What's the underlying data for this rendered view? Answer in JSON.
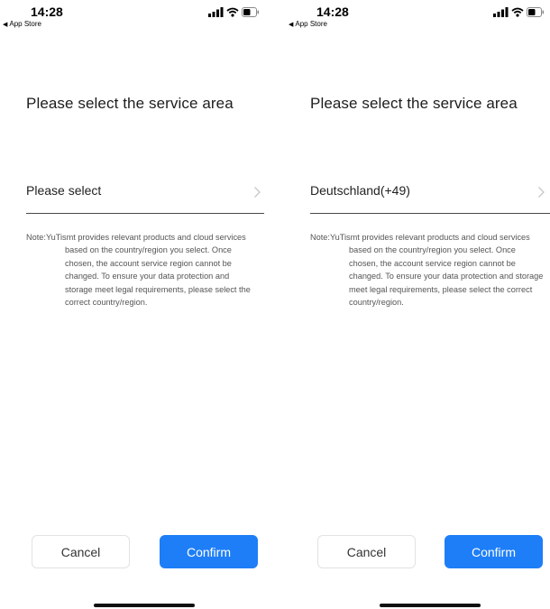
{
  "screens": [
    {
      "status_bar": {
        "time": "14:28",
        "back_label": "App Store",
        "back_arrow": "◀"
      },
      "title": "Please select the service area",
      "selector": {
        "value": "Please select",
        "chevron_icon": "chevron-right-icon"
      },
      "note": "Note:YuTismt provides relevant products and cloud services based on the country/region you select. Once chosen, the account service region cannot be changed. To ensure your data protection and storage meet legal requirements, please select the correct country/region.",
      "buttons": {
        "cancel": "Cancel",
        "confirm": "Confirm"
      }
    },
    {
      "status_bar": {
        "time": "14:28",
        "back_label": "App Store",
        "back_arrow": "◀"
      },
      "title": "Please select the service area",
      "selector": {
        "value": "Deutschland(+49)",
        "chevron_icon": "chevron-right-icon"
      },
      "note": "Note:YuTismt provides relevant products and cloud services based on the country/region you select. Once chosen, the account service region cannot be changed. To ensure your data protection and storage meet legal requirements, please select the correct country/region.",
      "buttons": {
        "cancel": "Cancel",
        "confirm": "Confirm"
      }
    }
  ],
  "colors": {
    "accent": "#1e7ef7",
    "divider": "#4a4a4a",
    "note_text": "#555555",
    "chevron": "#c7c7cc"
  }
}
